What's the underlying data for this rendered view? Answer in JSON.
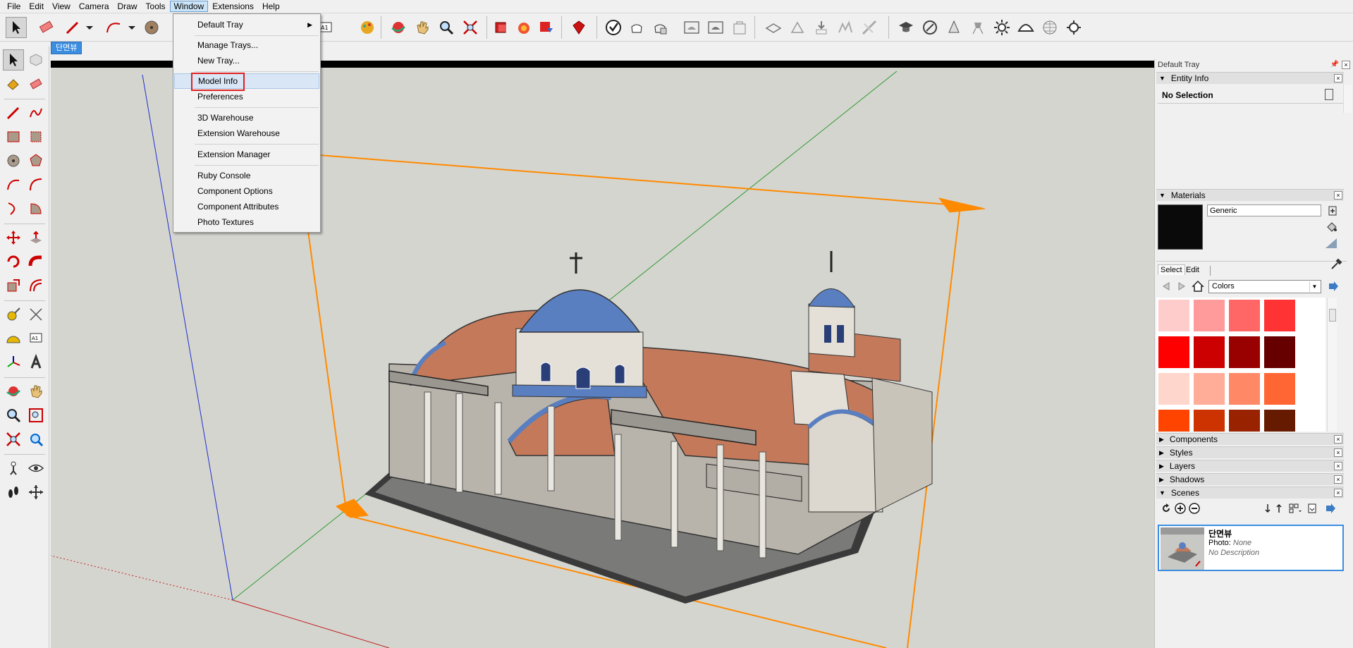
{
  "menubar": {
    "items": [
      "File",
      "Edit",
      "View",
      "Camera",
      "Draw",
      "Tools",
      "Window",
      "Extensions",
      "Help"
    ],
    "active": "Window"
  },
  "scene_tab": {
    "label": "단면뷰"
  },
  "window_menu": {
    "items": [
      {
        "label": "Default Tray",
        "submenu": true
      },
      {
        "label": "Manage Trays..."
      },
      {
        "label": "New Tray..."
      },
      {
        "label": "Model Info",
        "highlighted": true
      },
      {
        "label": "Preferences"
      },
      {
        "label": "3D Warehouse"
      },
      {
        "label": "Extension Warehouse"
      },
      {
        "label": "Extension Manager"
      },
      {
        "label": "Ruby Console"
      },
      {
        "label": "Component Options"
      },
      {
        "label": "Component Attributes"
      },
      {
        "label": "Photo Textures"
      }
    ],
    "highlight_color": "#e02020"
  },
  "tray": {
    "title": "Default Tray",
    "entity_info": {
      "header": "Entity Info",
      "selection": "No Selection"
    },
    "materials": {
      "header": "Materials",
      "name_value": "Generic",
      "tabs": [
        "Select",
        "Edit"
      ],
      "library": "Colors",
      "swatches": [
        "#ffcccc",
        "#ff9b9b",
        "#ff6666",
        "#ff3333",
        "#ff0000",
        "#cc0000",
        "#990000",
        "#660000",
        "#ffd6cc",
        "#ffad99",
        "#ff8866",
        "#ff6633",
        "#ff4400",
        "#cc3300",
        "#992200",
        "#661a00"
      ]
    },
    "collapsed_panels": [
      "Components",
      "Styles",
      "Layers",
      "Shadows"
    ],
    "scenes": {
      "header": "Scenes",
      "scene_name": "단면뷰",
      "photo_label": "Photo:",
      "photo_value": "None",
      "description": "No Description"
    }
  },
  "colors": {
    "viewport_bg": "#d5d5d0",
    "accent": "#3b8de0",
    "section_plane": "#ff8a00",
    "dome": "#5a7fc0",
    "roof": "#c47a5a"
  }
}
